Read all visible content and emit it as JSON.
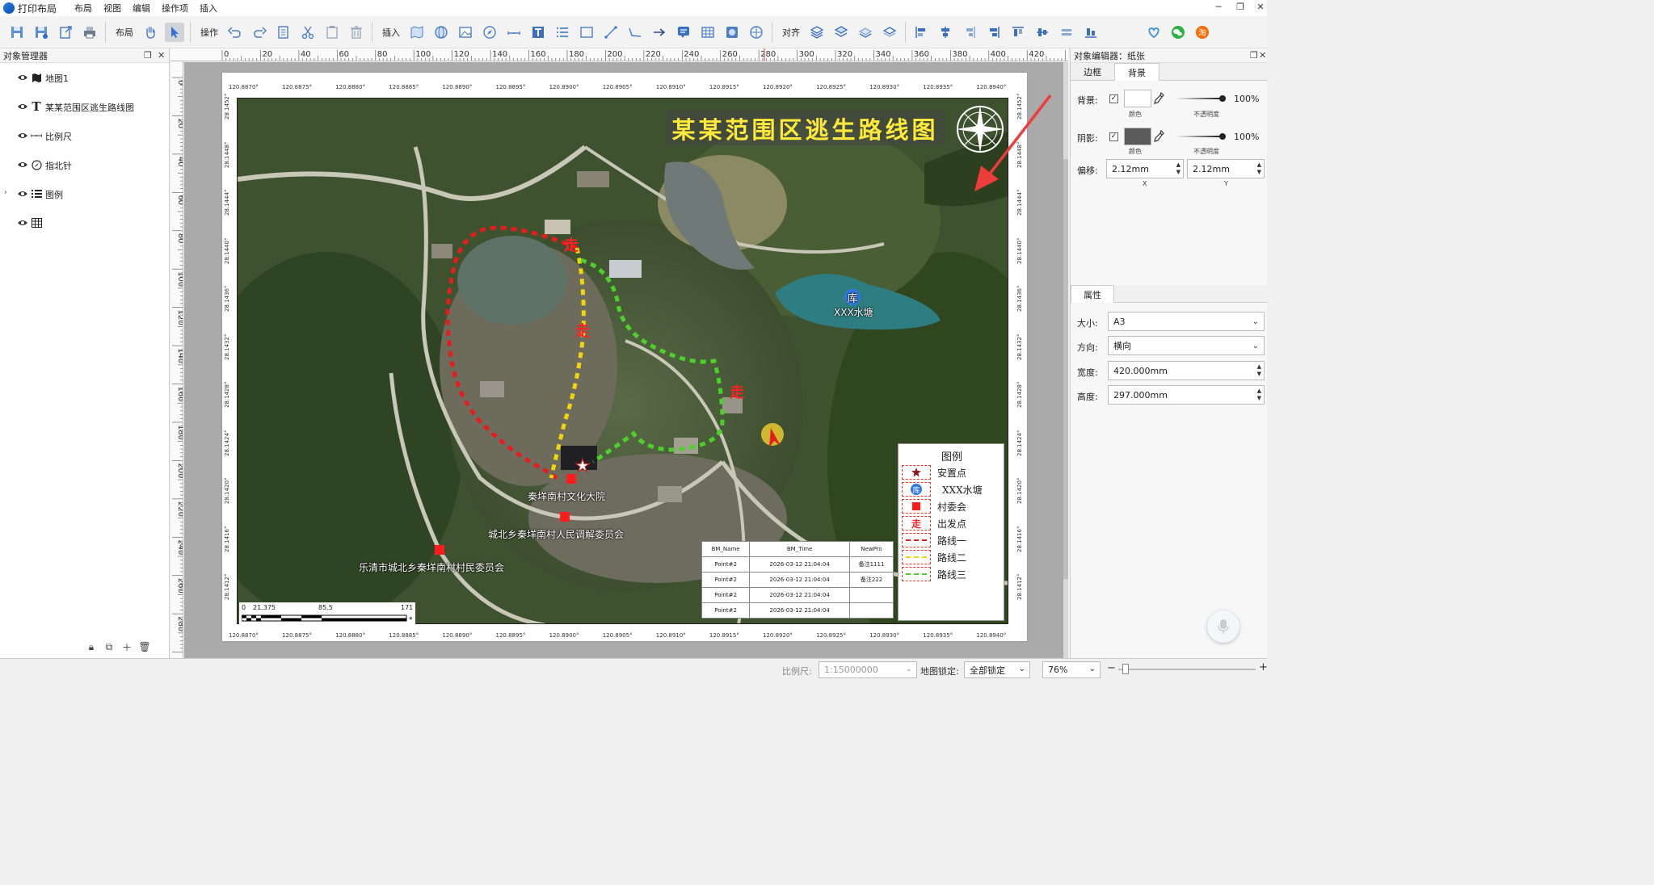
{
  "app": {
    "title": "打印布局",
    "menus": [
      "布局",
      "视图",
      "编辑",
      "操作项",
      "插入"
    ]
  },
  "toolbar": {
    "layout_label": "布局",
    "ops_label": "操作",
    "insert_label": "插入",
    "align_label": "对齐"
  },
  "object_manager": {
    "title": "对象管理器",
    "items": [
      {
        "label": "地图1",
        "icon": "map-icon"
      },
      {
        "label": "某某范围区逃生路线图",
        "icon": "text-icon"
      },
      {
        "label": "比例尺",
        "icon": "scalebar-icon"
      },
      {
        "label": "指北针",
        "icon": "compass-icon"
      },
      {
        "label": "图例",
        "icon": "legend-icon"
      },
      {
        "label": "",
        "icon": "table-icon"
      }
    ]
  },
  "ruler": {
    "top": [
      "0",
      "20",
      "40",
      "60",
      "80",
      "100",
      "120",
      "140",
      "160",
      "180",
      "200",
      "220",
      "240",
      "260",
      "280",
      "300",
      "320",
      "340",
      "360",
      "380",
      "400",
      "420"
    ],
    "left": [
      "0",
      "20",
      "40",
      "60",
      "80",
      "100",
      "120",
      "140",
      "160",
      "180",
      "200",
      "220",
      "240",
      "260",
      "280"
    ]
  },
  "map": {
    "title": "某某范围区逃生路线图",
    "top_lon": [
      "120.8870°",
      "120.8875°",
      "120.8880°",
      "120.8885°",
      "120.8890°",
      "120.8895°",
      "120.8900°",
      "120.8905°",
      "120.8910°",
      "120.8915°",
      "120.8920°",
      "120.8925°",
      "120.8930°",
      "120.8935°",
      "120.8940°"
    ],
    "lat_left": [
      "28.1452°",
      "28.1448°",
      "28.1444°",
      "28.1440°",
      "28.1436°",
      "28.1432°",
      "28.1428°",
      "28.1424°",
      "28.1420°",
      "28.1416°",
      "28.1412°"
    ],
    "lat_right": [
      "28.1452°",
      "28.1448°",
      "28.1444°",
      "28.1440°",
      "28.1436°",
      "28.1432°",
      "28.1428°",
      "28.1424°",
      "28.1420°",
      "28.1416°",
      "28.1412°"
    ],
    "labels": {
      "pond": "XXX水塘",
      "pond_badge": "库",
      "culture": "秦垟南村文化大院",
      "mediation": "城北乡秦垟南村人民调解委员会",
      "villagers": "乐清市城北乡秦垟南村村民委员会"
    },
    "scale": {
      "t0": "0",
      "t1": "21.375",
      "t2": "85.5",
      "t3": "171"
    }
  },
  "legend": {
    "title": "图例",
    "items": [
      "安置点",
      "XXX水塘",
      "村委会",
      "出发点",
      "路线一",
      "路线二",
      "路线三"
    ],
    "pond_badge": "库"
  },
  "attr_table": {
    "headers": [
      "BM_Name",
      "BM_Time",
      "NewPro"
    ],
    "rows": [
      [
        "Point#2",
        "2026-03-12 21:04:04",
        "备注1111"
      ],
      [
        "Point#2",
        "2026-03-12 21:04:04",
        "备注222"
      ],
      [
        "Point#2",
        "2026-03-12 21:04:04",
        ""
      ],
      [
        "Point#2",
        "2026-03-12 21:04:04",
        ""
      ]
    ]
  },
  "editor": {
    "title": "对象编辑器：纸张",
    "tabs": [
      "边框",
      "背景"
    ],
    "bg_label": "背景:",
    "shadow_label": "阴影:",
    "color_label": "颜色",
    "opacity_label": "不透明度",
    "bg_opacity": "100%",
    "shadow_opacity": "100%",
    "offset_label": "偏移:",
    "offset_x": "2.12mm",
    "offset_y": "2.12mm",
    "x_label": "X",
    "y_label": "Y",
    "props_tab": "属性",
    "size_label": "大小:",
    "size_value": "A3",
    "orient_label": "方向:",
    "orient_value": "横向",
    "width_label": "宽度:",
    "width_value": "420.000mm",
    "height_label": "高度:",
    "height_value": "297.000mm",
    "bg_color": "#ffffff",
    "shadow_color": "#5a5a5a"
  },
  "status": {
    "scale_label": "比例尺:",
    "scale_value": "1:15000000",
    "lock_label": "地图锁定:",
    "lock_value": "全部锁定",
    "zoom": "76%"
  }
}
